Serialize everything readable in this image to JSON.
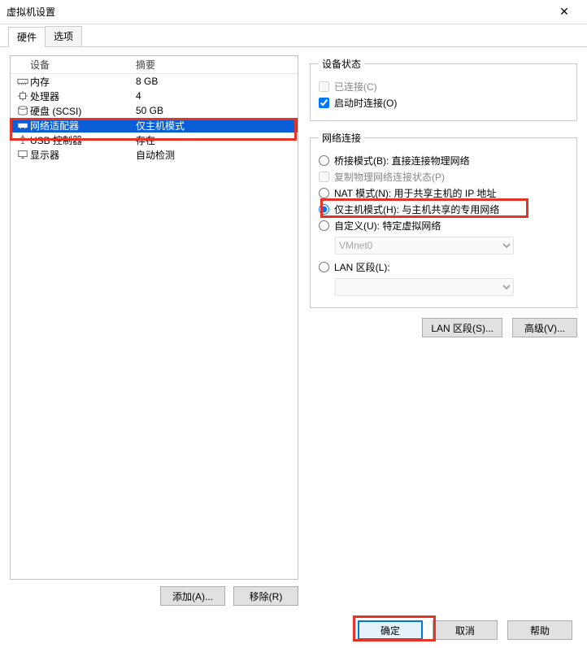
{
  "title": "虚拟机设置",
  "tabs": {
    "hardware": "硬件",
    "options": "选项"
  },
  "hw": {
    "header_device": "设备",
    "header_summary": "摘要",
    "rows": [
      {
        "device": "内存",
        "summary": "8 GB"
      },
      {
        "device": "处理器",
        "summary": "4"
      },
      {
        "device": "硬盘 (SCSI)",
        "summary": "50 GB"
      },
      {
        "device": "网络适配器",
        "summary": "仅主机模式"
      },
      {
        "device": "USB 控制器",
        "summary": "存在"
      },
      {
        "device": "显示器",
        "summary": "自动检测"
      }
    ],
    "add_btn": "添加(A)...",
    "remove_btn": "移除(R)"
  },
  "right": {
    "state_legend": "设备状态",
    "connected": "已连接(C)",
    "connect_at_poweron": "启动时连接(O)",
    "netconn_legend": "网络连接",
    "bridged": "桥接模式(B): 直接连接物理网络",
    "replicate": "复制物理网络连接状态(P)",
    "nat": "NAT 模式(N): 用于共享主机的 IP 地址",
    "hostonly": "仅主机模式(H): 与主机共享的专用网络",
    "custom": "自定义(U): 特定虚拟网络",
    "custom_value": "VMnet0",
    "lanseg": "LAN 区段(L):",
    "lanseg_value": "",
    "lanseg_btn": "LAN 区段(S)...",
    "advanced_btn": "高级(V)..."
  },
  "dlg": {
    "ok": "确定",
    "cancel": "取消",
    "help": "帮助"
  }
}
